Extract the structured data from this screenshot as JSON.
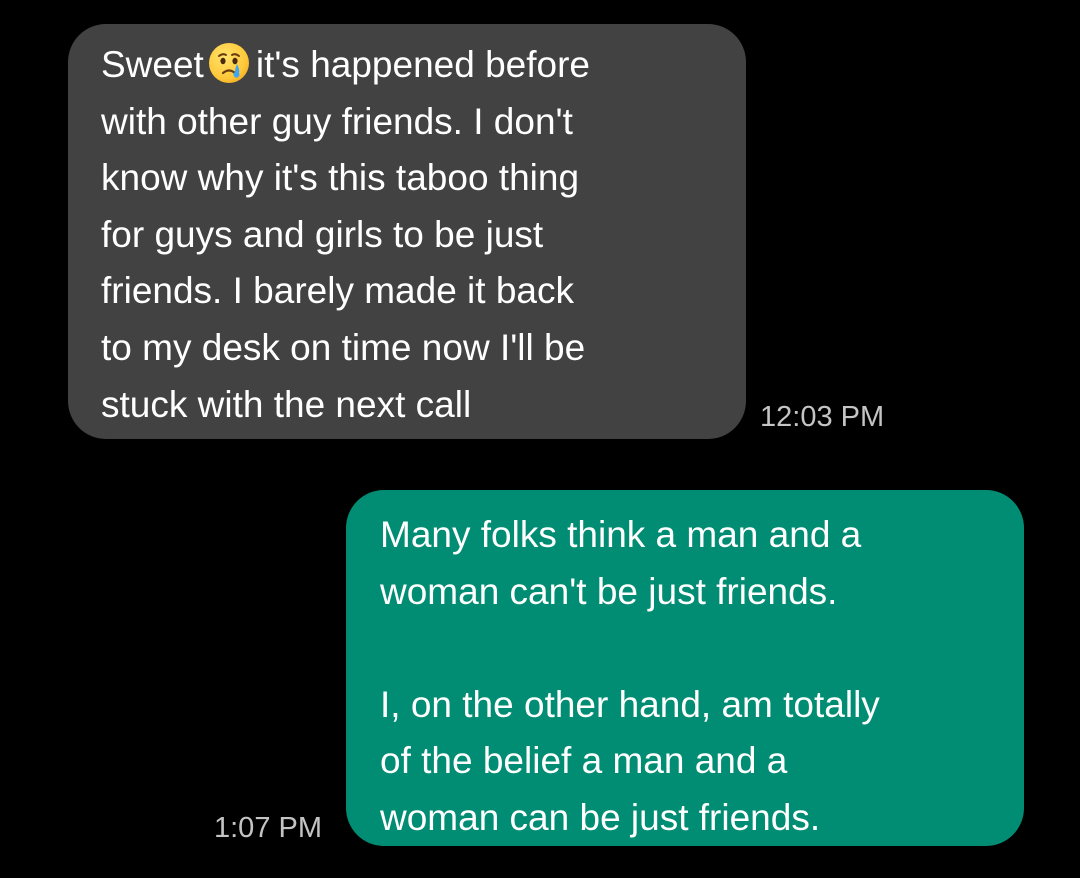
{
  "conversation": {
    "incoming_message": {
      "first_word": "Sweet",
      "emoji": "crying-face-emoji",
      "first_line_rest": "it's happened before",
      "lines": [
        "with other guy friends. I don't",
        "know why it's this taboo thing",
        "for guys and girls to be just",
        "friends. I barely made it back",
        "to my desk on time now I'll be",
        "stuck with the next call"
      ],
      "timestamp": "12:03 PM",
      "bubble_color": "#424242"
    },
    "outgoing_message": {
      "paragraph_1": [
        "Many folks think a man and a",
        "woman can't be just friends."
      ],
      "paragraph_2": [
        "I, on the other hand, am totally",
        "of the belief a man and a",
        "woman can be just friends."
      ],
      "timestamp": "1:07 PM",
      "bubble_color": "#008d73"
    }
  },
  "colors": {
    "background": "#000000",
    "text": "#ffffff",
    "timestamp": "#c4c4c4"
  }
}
